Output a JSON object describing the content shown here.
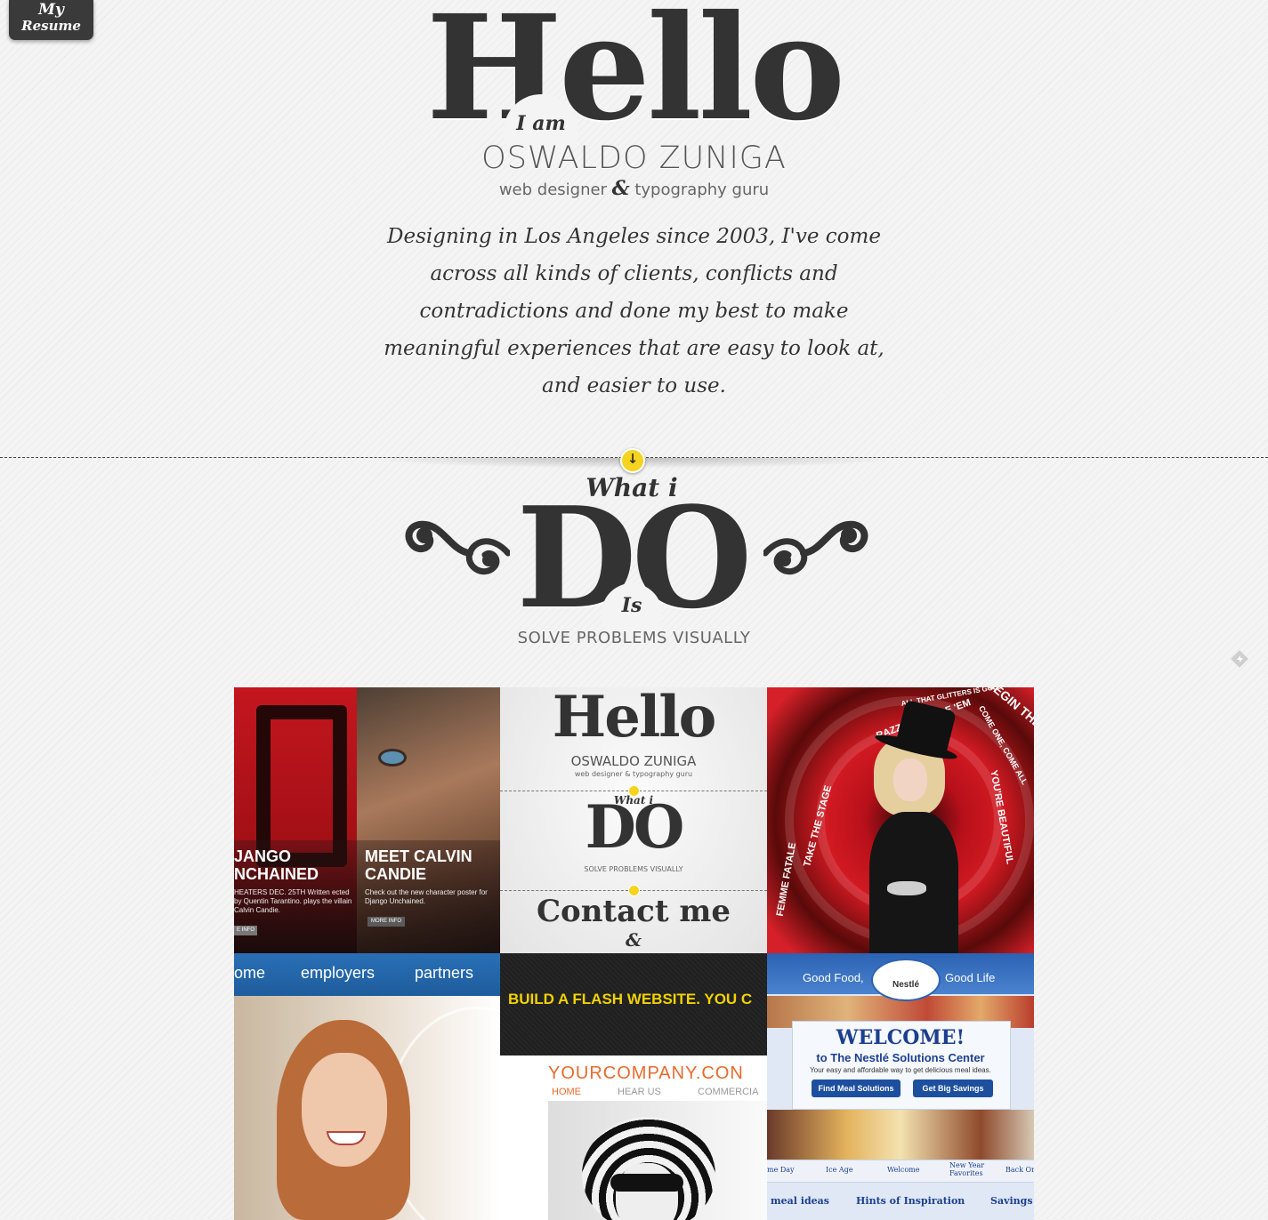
{
  "resume_tab": {
    "line1": "My",
    "line2": "Resume"
  },
  "hero": {
    "title": "Hello",
    "i_am": "I am",
    "name": "OSWALDO ZUNIGA",
    "tagline_left": "web designer",
    "tagline_amp": "&",
    "tagline_right": "typography guru",
    "intro": "Designing in Los Angeles since 2003, I've come across all kinds of clients, conflicts and contradictions and done my best to make meaningful experiences that are easy to look at, and easier to use."
  },
  "scroll_arrow": "↓",
  "what_i_do": {
    "what_i": "What i",
    "title": "DO",
    "is": "Is",
    "subtitle": "SOLVE PROBLEMS VISUALLY"
  },
  "portfolio": {
    "t1": {
      "heading_left": "JANGO NCHAINED",
      "heading_right": "MEET CALVIN CANDIE",
      "body_left": "HEATERS DEC. 25TH Written ected by Quentin Tarantino. plays the villain Calvin Candie.",
      "body_right": "Check out the new character poster for Django Unchained.",
      "btn_left": "E INFO",
      "btn_right": "MORE INFO"
    },
    "t2": {
      "hello": "Hello",
      "name": "OSWALDO ZUNIGA",
      "tagline": "web designer & typography guru",
      "what_i": "What i",
      "do": "DO",
      "solve": "SOLVE PROBLEMS VISUALLY",
      "contact": "Contact me",
      "amp": "&"
    },
    "t3": {
      "lines": [
        "RAZZLE DAZZLE 'EM",
        "ALL THAT GLITTERS IS GOLD",
        "TAKE THE STAGE",
        "YOU'RE BEAUTIFUL",
        "COME ONE, COME ALL",
        "FEMME FATALE",
        "BEGIN THE"
      ]
    },
    "t4": {
      "nav": [
        "ome",
        "employers",
        "partners"
      ]
    },
    "t5": {
      "banner": "BUILD A FLASH WEBSITE. YOU C",
      "site": "YOURCOMPANY.CON",
      "nav": [
        "HOME",
        "HEAR US",
        "COMMERCIA"
      ]
    },
    "t6": {
      "header_left": "Good Food,",
      "header_right": "Good Life",
      "logo": "Nestlé",
      "welcome": "WELCOME!",
      "sub": "to The Nestlé Solutions Center",
      "sub2": "Your easy and affordable way to get delicious meal ideas.",
      "btn1": "Find Meal Solutions",
      "btn2": "Get Big Savings",
      "menu": [
        "me Day",
        "Ice Age",
        "Welcome",
        "New Year Favorites",
        "Back Or"
      ],
      "links": [
        "meal ideas",
        "Hints of Inspiration",
        "Savings c"
      ]
    }
  },
  "colors": {
    "accent": "#f6d31e",
    "ink": "#333333",
    "background": "#f4f4f4"
  }
}
